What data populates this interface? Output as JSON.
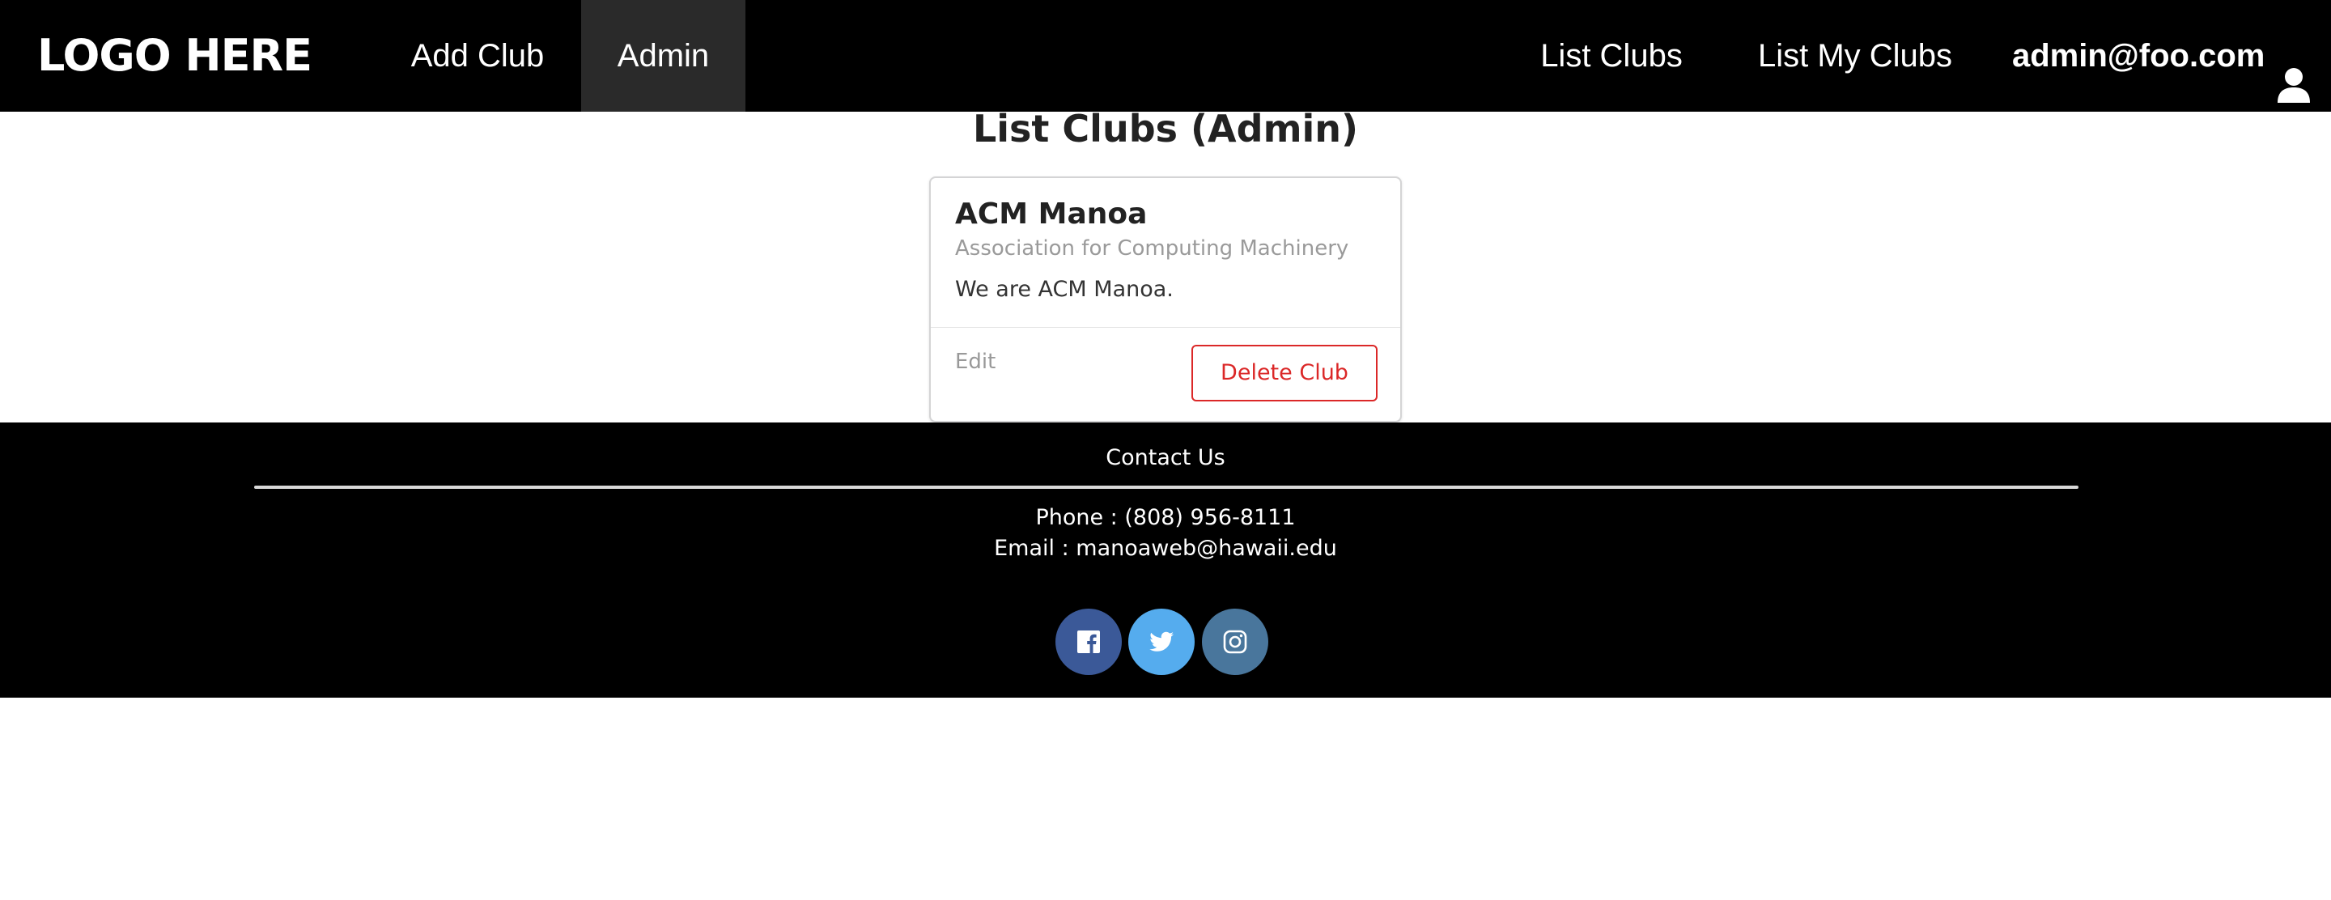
{
  "navbar": {
    "logo": "LOGO HERE",
    "items": [
      {
        "label": "Add Club"
      },
      {
        "label": "Admin",
        "active": true
      },
      {
        "label": "List Clubs"
      },
      {
        "label": "List My Clubs"
      }
    ],
    "user": {
      "label": "admin@foo.com",
      "icon": "user-icon"
    }
  },
  "main": {
    "title": "List Clubs (Admin)",
    "card": {
      "name": "ACM Manoa",
      "meta": "Association for Computing Machinery",
      "description": "We are ACM Manoa.",
      "edit_label": "Edit",
      "delete_label": "Delete Club"
    }
  },
  "footer": {
    "contact_title": "Contact Us",
    "phone": "Phone : (808) 956-8111",
    "email": "Email : manoaweb@hawaii.edu",
    "social": [
      {
        "icon": "facebook-icon",
        "color": "#3b5998"
      },
      {
        "icon": "twitter-icon",
        "color": "#55acee"
      },
      {
        "icon": "instagram-icon",
        "color": "#49769c"
      }
    ]
  },
  "colors": {
    "navbar_bg": "#000000",
    "active_nav_bg": "#2a2a2a",
    "delete_red": "#db2828"
  }
}
